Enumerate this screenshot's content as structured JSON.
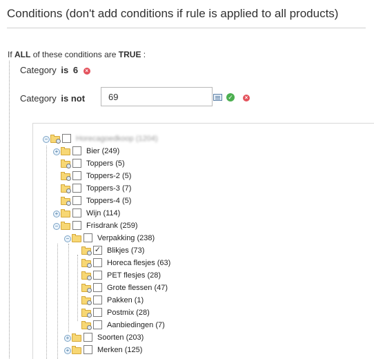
{
  "section": {
    "title": "Conditions (don't add conditions if rule is applied to all products)"
  },
  "intro": {
    "prefix": "If",
    "aggregator": "ALL",
    "middle": "of these conditions are",
    "value": "TRUE",
    "suffix": ":"
  },
  "conditions": [
    {
      "attribute": "Category",
      "operator": "is",
      "value": "6",
      "remove_icon": "x-circle-icon"
    },
    {
      "attribute": "Category",
      "operator": "is not",
      "value": "69",
      "chooser_icon": "list-icon",
      "apply_icon": "check-circle-icon",
      "remove_icon": "x-circle-icon"
    }
  ],
  "tree": {
    "root_label": "Horecagoedkoop (1204)",
    "nodes": [
      {
        "label": "Bier (249)",
        "depth": 1,
        "expandable": true,
        "checked": false
      },
      {
        "label": "Toppers (5)",
        "depth": 1,
        "expandable": false,
        "checked": false
      },
      {
        "label": "Toppers-2 (5)",
        "depth": 1,
        "expandable": false,
        "checked": false
      },
      {
        "label": "Toppers-3 (7)",
        "depth": 1,
        "expandable": false,
        "checked": false
      },
      {
        "label": "Toppers-4 (5)",
        "depth": 1,
        "expandable": false,
        "checked": false
      },
      {
        "label": "Wijn (114)",
        "depth": 1,
        "expandable": true,
        "checked": false
      },
      {
        "label": "Frisdrank (259)",
        "depth": 1,
        "expandable": true,
        "expanded": true,
        "checked": false
      },
      {
        "label": "Verpakking (238)",
        "depth": 2,
        "expandable": true,
        "expanded": true,
        "checked": false
      },
      {
        "label": "Blikjes (73)",
        "depth": 3,
        "expandable": false,
        "checked": true
      },
      {
        "label": "Horeca flesjes (63)",
        "depth": 3,
        "expandable": false,
        "checked": false
      },
      {
        "label": "PET flesjes (28)",
        "depth": 3,
        "expandable": false,
        "checked": false
      },
      {
        "label": "Grote flessen (47)",
        "depth": 3,
        "expandable": false,
        "checked": false
      },
      {
        "label": "Pakken (1)",
        "depth": 3,
        "expandable": false,
        "checked": false
      },
      {
        "label": "Postmix (28)",
        "depth": 3,
        "expandable": false,
        "checked": false
      },
      {
        "label": "Aanbiedingen (7)",
        "depth": 3,
        "expandable": false,
        "checked": false
      },
      {
        "label": "Soorten (203)",
        "depth": 2,
        "expandable": true,
        "checked": false
      },
      {
        "label": "Merken (125)",
        "depth": 2,
        "expandable": true,
        "checked": false
      }
    ]
  }
}
